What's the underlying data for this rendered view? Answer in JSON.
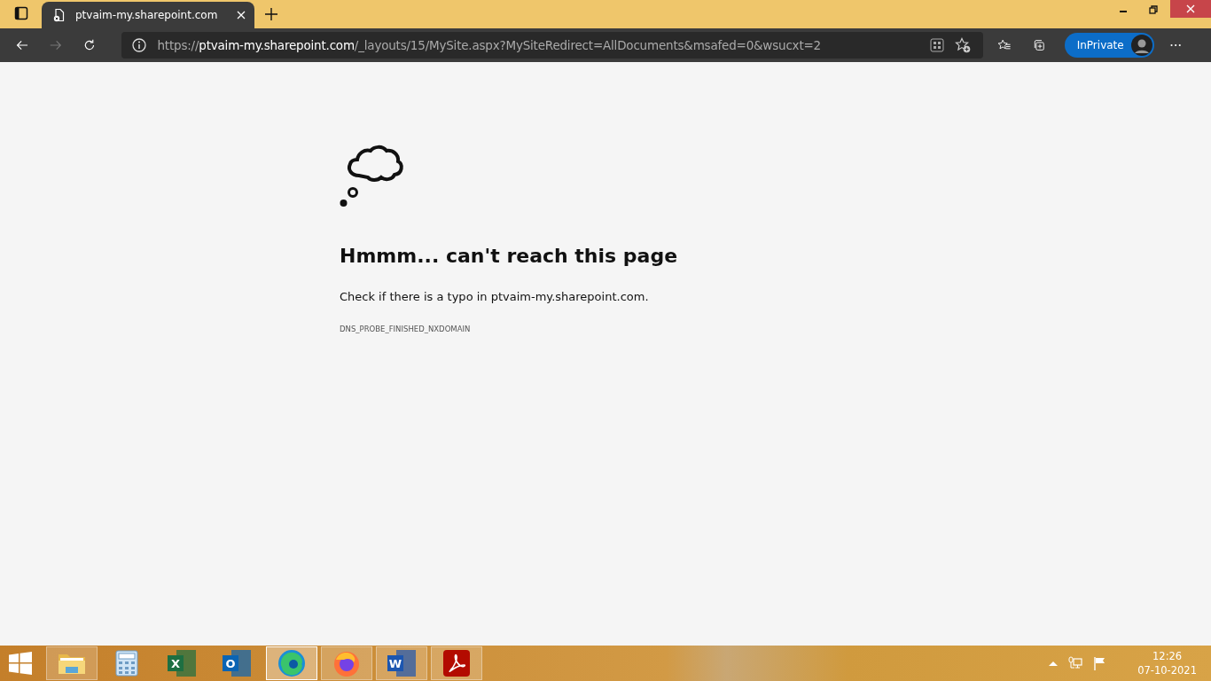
{
  "tab": {
    "title": "ptvaim-my.sharepoint.com"
  },
  "address": {
    "scheme": "https://",
    "host": "ptvaim-my.sharepoint.com",
    "path": "/_layouts/15/MySite.aspx?MySiteRedirect=AllDocuments&msafed=0&wsucxt=2"
  },
  "profile": {
    "label": "InPrivate"
  },
  "error": {
    "title": "Hmmm... can't reach this page",
    "message": "Check if there is a typo in ptvaim-my.sharepoint.com.",
    "code": "DNS_PROBE_FINISHED_NXDOMAIN"
  },
  "taskbar": {
    "apps": [
      {
        "kind": "folder",
        "running": true,
        "selected": false
      },
      {
        "kind": "calculator",
        "running": false,
        "selected": false
      },
      {
        "kind": "sheet",
        "glyph": "X",
        "running": false,
        "selected": false
      },
      {
        "kind": "mail",
        "glyph": "O",
        "running": false,
        "selected": false
      },
      {
        "kind": "browser-swirl",
        "running": true,
        "selected": true
      },
      {
        "kind": "fox",
        "running": true,
        "selected": false
      },
      {
        "kind": "doc",
        "glyph": "W",
        "running": true,
        "selected": false
      },
      {
        "kind": "pdf",
        "running": true,
        "selected": false
      }
    ],
    "time": "12:26",
    "date": "07-10-2021"
  }
}
